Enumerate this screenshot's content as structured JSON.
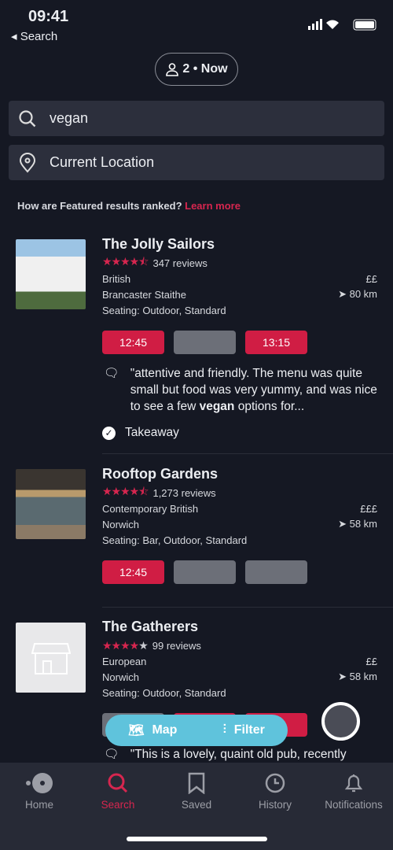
{
  "status": {
    "time": "09:41",
    "back": "Search"
  },
  "party": {
    "label": "2 • Now"
  },
  "search": {
    "value": "vegan",
    "location": "Current Location"
  },
  "ranking": {
    "text": "How are Featured results ranked? ",
    "link": "Learn more"
  },
  "results": [
    {
      "name": "The Jolly Sailors",
      "rating": 4.5,
      "reviews": "347 reviews",
      "cuisine": "British",
      "price": "££",
      "location": "Brancaster Staithe",
      "distance": "80 km",
      "seating": "Seating: Outdoor, Standard",
      "slots": [
        "12:45",
        "",
        "13:15"
      ],
      "review_pre": "\"attentive and friendly. The menu was quite small but food was very yummy, and was nice to see a few ",
      "review_bold": "vegan",
      "review_post": " options for...",
      "feature": "Takeaway"
    },
    {
      "name": "Rooftop Gardens",
      "rating": 4.5,
      "reviews": "1,273 reviews",
      "cuisine": "Contemporary British",
      "price": "£££",
      "location": "Norwich",
      "distance": "58 km",
      "seating": "Seating: Bar, Outdoor, Standard",
      "slots": [
        "12:45",
        "",
        ""
      ]
    },
    {
      "name": "The Gatherers",
      "rating": 4,
      "reviews": "99 reviews",
      "cuisine": "European",
      "price": "££",
      "location": "Norwich",
      "distance": "58 km",
      "seating": "Seating: Outdoor, Standard",
      "review_pre": "\"This is a lovely, quaint old pub, recently"
    }
  ],
  "fab": {
    "map": "Map",
    "filter": "Filter"
  },
  "tabs": [
    "Home",
    "Search",
    "Saved",
    "History",
    "Notifications"
  ],
  "colors": {
    "accent": "#d01d44",
    "background": "#151823",
    "fab": "#5fc3dc"
  }
}
